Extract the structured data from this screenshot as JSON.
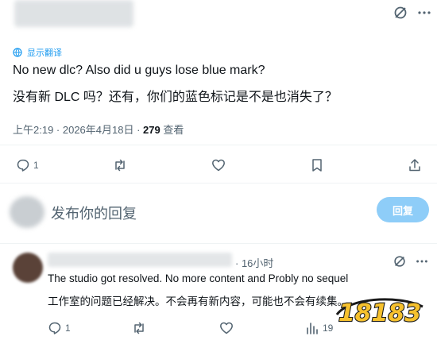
{
  "tweet": {
    "translate_label": "显示翻译",
    "text_en": "No new dlc? Also did u guys lose blue mark?",
    "text_zh": "没有新 DLC 吗？还有，你们的蓝色标记是不是也消失了？",
    "time": "上午2:19 · 2026年4月18日 · ",
    "views_count": "279",
    "views_label": " 查看",
    "replies": "1"
  },
  "composer": {
    "placeholder": "发布你的回复",
    "reply_button": "回复"
  },
  "reply": {
    "time": "· 16小时",
    "text_en": "The studio got resolved. No more content and Probly no sequel",
    "text_zh": "工作室的问题已经解决。不会再有新内容，可能也不会有续集。",
    "replies": "1",
    "views": "19"
  },
  "watermark": {
    "text": "18183"
  },
  "colors": {
    "accent": "#1d9bf0",
    "muted": "#536471",
    "button_disabled": "#8ecdf8"
  }
}
